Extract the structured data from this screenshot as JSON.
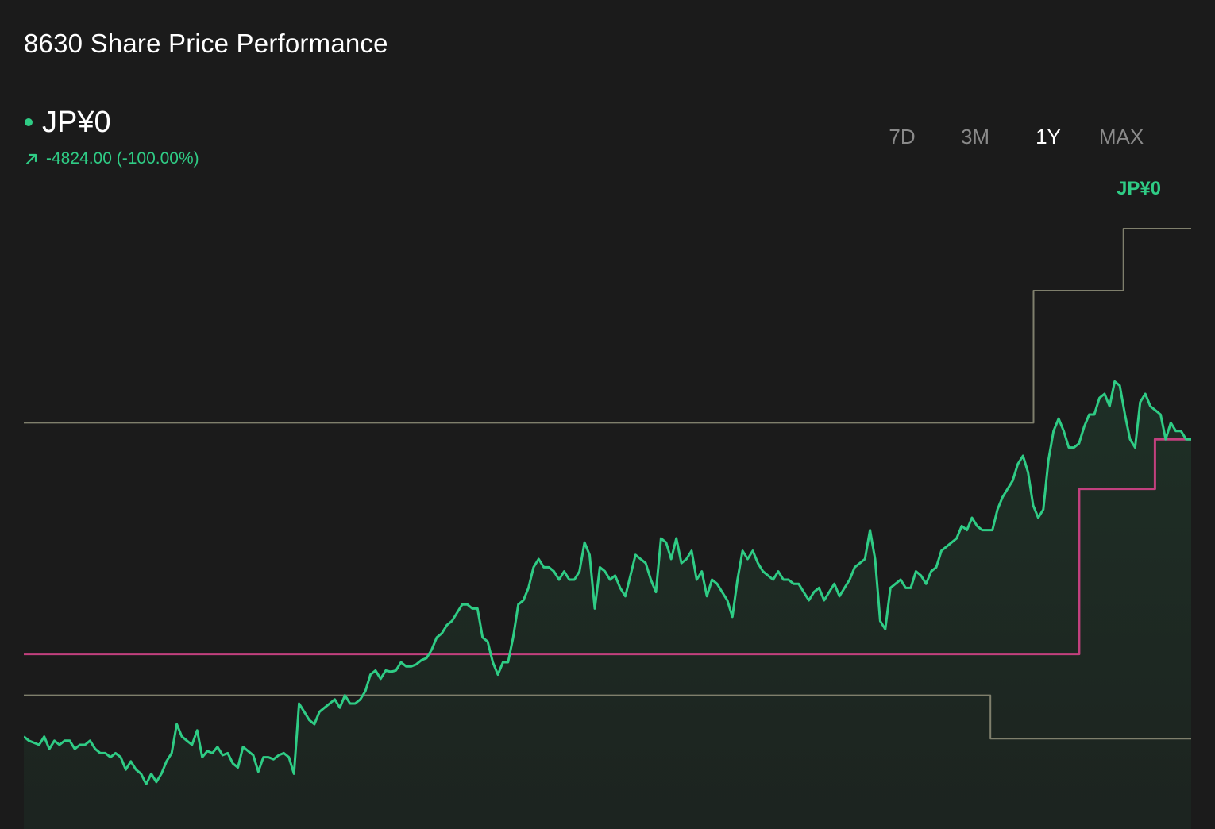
{
  "header": {
    "title": "8630 Share Price Performance"
  },
  "price": {
    "current": "JP¥0",
    "change": "-4824.00 (-100.00%)"
  },
  "colors": {
    "background": "#1b1b1b",
    "price_line": "#2fcc85",
    "area_fill": "#1f3328",
    "band_lines": "#7f7f6c",
    "step_line": "#c2407e",
    "text_muted": "#8a8a8a"
  },
  "range_tabs": [
    {
      "label": "7D",
      "active": false
    },
    {
      "label": "3M",
      "active": false
    },
    {
      "label": "1Y",
      "active": true
    },
    {
      "label": "MAX",
      "active": false
    }
  ],
  "chart_data": {
    "type": "line",
    "ylim": [
      0,
      1
    ],
    "series": [
      {
        "role": "price",
        "values": [
          0.12,
          0.11,
          0.105,
          0.1,
          0.12,
          0.09,
          0.11,
          0.1,
          0.11,
          0.11,
          0.09,
          0.1,
          0.1,
          0.11,
          0.09,
          0.08,
          0.08,
          0.07,
          0.08,
          0.07,
          0.04,
          0.06,
          0.04,
          0.03,
          0.005,
          0.03,
          0.01,
          0.03,
          0.06,
          0.08,
          0.15,
          0.12,
          0.11,
          0.1,
          0.135,
          0.07,
          0.085,
          0.08,
          0.095,
          0.075,
          0.08,
          0.055,
          0.045,
          0.095,
          0.085,
          0.075,
          0.035,
          0.07,
          0.07,
          0.065,
          0.075,
          0.08,
          0.07,
          0.03,
          0.2,
          0.18,
          0.16,
          0.15,
          0.18,
          0.19,
          0.2,
          0.21,
          0.19,
          0.22,
          0.2,
          0.2,
          0.21,
          0.23,
          0.27,
          0.28,
          0.26,
          0.28,
          0.277,
          0.28,
          0.3,
          0.29,
          0.29,
          0.295,
          0.305,
          0.31,
          0.33,
          0.36,
          0.37,
          0.39,
          0.4,
          0.42,
          0.44,
          0.44,
          0.43,
          0.43,
          0.36,
          0.35,
          0.3,
          0.27,
          0.3,
          0.3,
          0.36,
          0.44,
          0.45,
          0.48,
          0.53,
          0.55,
          0.53,
          0.53,
          0.52,
          0.5,
          0.52,
          0.5,
          0.5,
          0.52,
          0.59,
          0.56,
          0.43,
          0.53,
          0.52,
          0.5,
          0.51,
          0.48,
          0.46,
          0.51,
          0.56,
          0.55,
          0.54,
          0.5,
          0.47,
          0.6,
          0.59,
          0.55,
          0.6,
          0.54,
          0.55,
          0.57,
          0.5,
          0.52,
          0.46,
          0.5,
          0.49,
          0.47,
          0.45,
          0.41,
          0.5,
          0.57,
          0.55,
          0.57,
          0.54,
          0.52,
          0.51,
          0.5,
          0.52,
          0.5,
          0.5,
          0.49,
          0.49,
          0.47,
          0.45,
          0.47,
          0.48,
          0.45,
          0.47,
          0.49,
          0.46,
          0.48,
          0.5,
          0.53,
          0.54,
          0.55,
          0.62,
          0.55,
          0.4,
          0.38,
          0.48,
          0.49,
          0.5,
          0.48,
          0.48,
          0.52,
          0.51,
          0.49,
          0.52,
          0.53,
          0.57,
          0.58,
          0.59,
          0.6,
          0.63,
          0.62,
          0.65,
          0.63,
          0.62,
          0.62,
          0.62,
          0.67,
          0.7,
          0.72,
          0.74,
          0.78,
          0.8,
          0.76,
          0.68,
          0.65,
          0.67,
          0.79,
          0.86,
          0.89,
          0.86,
          0.82,
          0.82,
          0.83,
          0.87,
          0.9,
          0.9,
          0.94,
          0.95,
          0.92,
          0.98,
          0.97,
          0.9,
          0.84,
          0.82,
          0.93,
          0.95,
          0.92,
          0.91,
          0.9,
          0.84,
          0.88,
          0.86,
          0.86,
          0.84,
          0.84
        ]
      },
      {
        "role": "upper-band",
        "steps": [
          {
            "x0": 0,
            "x1": 0.865,
            "y": 0.88
          },
          {
            "x0": 0.865,
            "x1": 0.942,
            "y": 1.2
          },
          {
            "x0": 0.942,
            "x1": 1.0,
            "y": 1.35
          }
        ]
      },
      {
        "role": "lower-band",
        "steps": [
          {
            "x0": 0,
            "x1": 0.828,
            "y": 0.22
          },
          {
            "x0": 0.828,
            "x1": 1.0,
            "y": 0.115
          }
        ]
      },
      {
        "role": "step-line",
        "steps": [
          {
            "x0": 0,
            "x1": 0.904,
            "y": 0.32
          },
          {
            "x0": 0.904,
            "x1": 0.969,
            "y": 0.72
          },
          {
            "x0": 0.969,
            "x1": 1.0,
            "y": 0.84
          }
        ]
      }
    ],
    "end_label": "JP¥0"
  }
}
